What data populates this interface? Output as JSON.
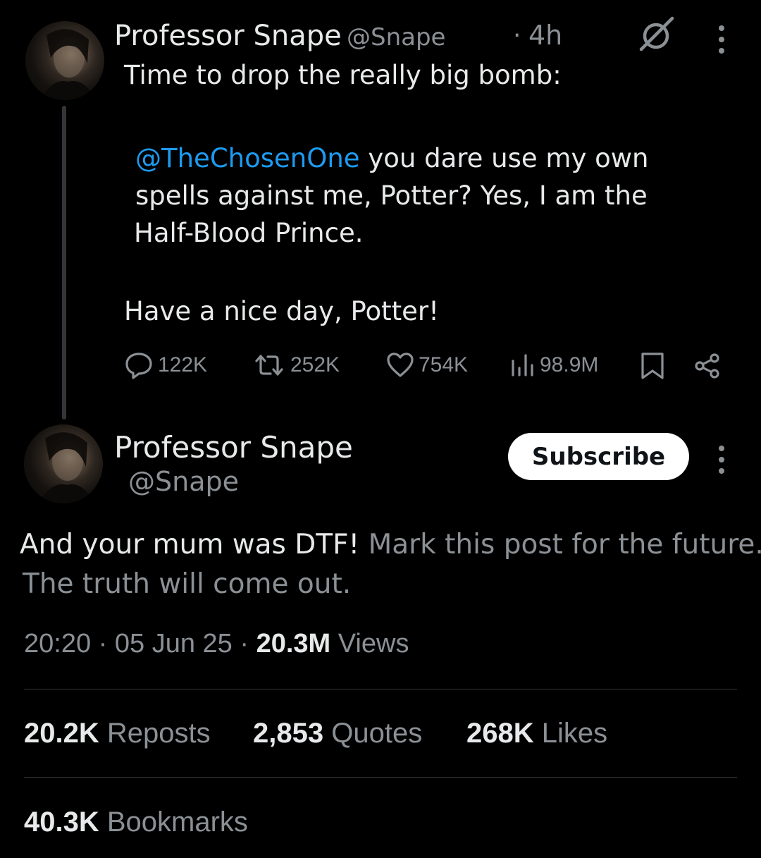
{
  "parent_post": {
    "author_name": "Professor Snape",
    "author_handle": "@Snape",
    "time_separator": "·",
    "time": "4h",
    "line1": "Time to drop the really big bomb:",
    "mention": "@TheChosenOne",
    "line2_rest": " you dare use my own",
    "line3": "spells against me, Potter?  Yes, I am the",
    "line4": "Half-Blood Prince.",
    "line5": "Have a nice day, Potter!",
    "replies": "122K",
    "reposts": "252K",
    "likes": "754K",
    "views": "98.9M"
  },
  "main_post": {
    "author_name": "Professor Snape",
    "author_handle": "@Snape",
    "subscribe_label": "Subscribe",
    "text_part1": "And your mum was DTF!",
    "text_part2": " Mark this post for the future.",
    "text_line2": "The truth will come out.",
    "time": "20:20",
    "date": "05 Jun 25",
    "dot": "·",
    "views_count": "20.3M",
    "views_label": "Views",
    "reposts_count": "20.2K",
    "reposts_label": "Reposts",
    "quotes_count": "2,853",
    "quotes_label": "Quotes",
    "likes_count": "268K",
    "likes_label": "Likes",
    "bookmarks_count": "40.3K",
    "bookmarks_label": "Bookmarks"
  },
  "colors": {
    "background": "#000000",
    "text": "#e7e9ea",
    "muted": "#8b9095",
    "mention": "#1d9bf0",
    "button_bg": "#ffffff"
  }
}
